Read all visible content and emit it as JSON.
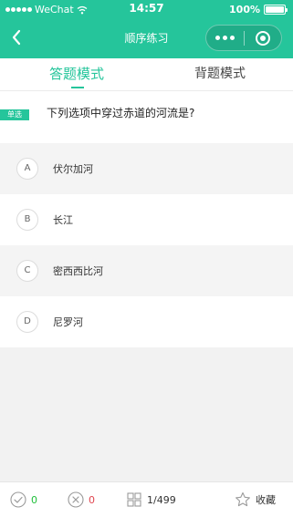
{
  "status_bar": {
    "carrier": "WeChat",
    "time": "14:57",
    "battery": "100%"
  },
  "nav": {
    "title": "顺序练习"
  },
  "tabs": [
    {
      "label": "答题模式",
      "active": true
    },
    {
      "label": "背题模式",
      "active": false
    }
  ],
  "question": {
    "type_badge": "单选",
    "text": "下列选项中穿过赤道的河流是?"
  },
  "options": [
    {
      "letter": "A",
      "text": "伏尔加河"
    },
    {
      "letter": "B",
      "text": "长江"
    },
    {
      "letter": "C",
      "text": "密西西比河"
    },
    {
      "letter": "D",
      "text": "尼罗河"
    }
  ],
  "bottom": {
    "correct_count": "0",
    "wrong_count": "0",
    "progress": "1/499",
    "favorite_label": "收藏"
  },
  "colors": {
    "accent": "#25c59b",
    "correct": "#1fbf3a",
    "wrong": "#e0454f"
  }
}
